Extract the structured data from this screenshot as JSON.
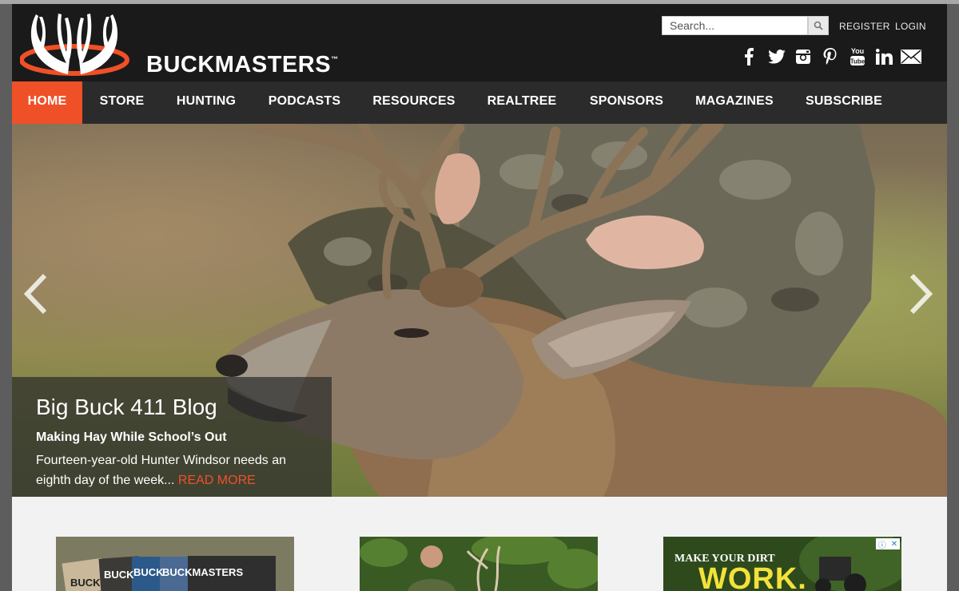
{
  "brand": {
    "name": "BUCKMASTERS",
    "trademark": "™",
    "accent": "#f05027"
  },
  "header": {
    "search": {
      "placeholder": "Search..."
    },
    "register_label": "REGISTER",
    "login_label": "LOGIN",
    "social": [
      "facebook-icon",
      "twitter-icon",
      "instagram-icon",
      "pinterest-icon",
      "youtube-icon",
      "linkedin-icon",
      "email-icon"
    ]
  },
  "nav": {
    "items": [
      {
        "label": "HOME",
        "active": true
      },
      {
        "label": "STORE"
      },
      {
        "label": "HUNTING"
      },
      {
        "label": "PODCASTS"
      },
      {
        "label": "RESOURCES"
      },
      {
        "label": "REALTREE"
      },
      {
        "label": "SPONSORS"
      },
      {
        "label": "MAGAZINES"
      },
      {
        "label": "SUBSCRIBE"
      }
    ]
  },
  "hero": {
    "title": "Big Buck 411 Blog",
    "subtitle": "Making Hay While School’s Out",
    "description": "Fourteen-year-old Hunter Windsor needs an eighth day of the week...",
    "read_more": "READ MORE"
  },
  "cards": {
    "magazines": {
      "labels": [
        "BUCK",
        "BUCK",
        "BUCK",
        "BUCKMASTERS"
      ]
    },
    "ad": {
      "line1": "MAKE YOUR DIRT",
      "line2": "WORK."
    }
  }
}
